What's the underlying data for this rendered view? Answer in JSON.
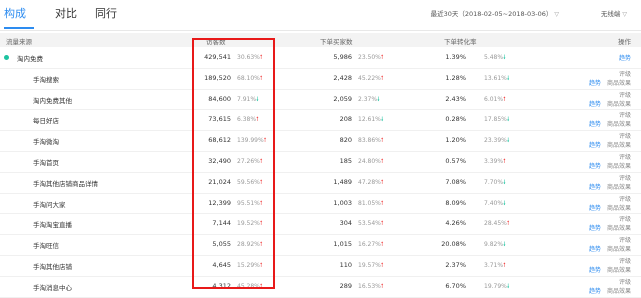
{
  "tabs": [
    {
      "label": "构成",
      "active": true
    },
    {
      "label": "对比",
      "active": false
    },
    {
      "label": "同行",
      "active": false
    }
  ],
  "date_range": "最近30天（2018-02-05~2018-03-06）",
  "terminal_select": "无线端",
  "headers": {
    "source": "流量来源",
    "visitors": "访客数",
    "buyers": "下单买家数",
    "conversion": "下单转化率",
    "actions": "操作"
  },
  "colors": {
    "accent": "#2d8cf0",
    "up": "#f04848",
    "down": "#1dc3a0",
    "highlight_box": "#e81919"
  },
  "rows": [
    {
      "source": "淘内免费",
      "is_parent": true,
      "visitors": "429,541",
      "visitors_pct": "30.63%",
      "visitors_trend": "up",
      "buyers": "5,986",
      "buyers_pct": "23.50%",
      "buyers_trend": "up",
      "conversion": "1.39%",
      "conversion_pct": "5.48%",
      "conversion_trend": "down",
      "actions": [
        "趋势"
      ]
    },
    {
      "source": "手淘搜索",
      "visitors": "189,520",
      "visitors_pct": "68.10%",
      "visitors_trend": "up",
      "buyers": "2,428",
      "buyers_pct": "45.22%",
      "buyers_trend": "up",
      "conversion": "1.28%",
      "conversion_pct": "13.61%",
      "conversion_trend": "down",
      "actions": [
        "评级",
        "趋势",
        "商品效果"
      ]
    },
    {
      "source": "淘内免费其他",
      "visitors": "84,600",
      "visitors_pct": "7.91%",
      "visitors_trend": "down",
      "buyers": "2,059",
      "buyers_pct": "2.37%",
      "buyers_trend": "down",
      "conversion": "2.43%",
      "conversion_pct": "6.01%",
      "conversion_trend": "up",
      "actions": [
        "评级",
        "趋势",
        "商品效果"
      ]
    },
    {
      "source": "每日好店",
      "visitors": "73,615",
      "visitors_pct": "6.38%",
      "visitors_trend": "up",
      "buyers": "208",
      "buyers_pct": "12.61%",
      "buyers_trend": "down",
      "conversion": "0.28%",
      "conversion_pct": "17.85%",
      "conversion_trend": "down",
      "actions": [
        "评级",
        "趋势",
        "商品效果"
      ]
    },
    {
      "source": "手淘微淘",
      "visitors": "68,612",
      "visitors_pct": "139.99%",
      "visitors_trend": "up",
      "buyers": "820",
      "buyers_pct": "83.86%",
      "buyers_trend": "up",
      "conversion": "1.20%",
      "conversion_pct": "23.39%",
      "conversion_trend": "down",
      "actions": [
        "评级",
        "趋势",
        "商品效果"
      ]
    },
    {
      "source": "手淘首页",
      "visitors": "32,490",
      "visitors_pct": "27.26%",
      "visitors_trend": "up",
      "buyers": "185",
      "buyers_pct": "24.80%",
      "buyers_trend": "up",
      "conversion": "0.57%",
      "conversion_pct": "3.39%",
      "conversion_trend": "up",
      "actions": [
        "评级",
        "趋势",
        "商品效果"
      ]
    },
    {
      "source": "手淘其他店铺商品详情",
      "visitors": "21,024",
      "visitors_pct": "59.56%",
      "visitors_trend": "up",
      "buyers": "1,489",
      "buyers_pct": "47.28%",
      "buyers_trend": "up",
      "conversion": "7.08%",
      "conversion_pct": "7.70%",
      "conversion_trend": "down",
      "actions": [
        "评级",
        "趋势",
        "商品效果"
      ]
    },
    {
      "source": "手淘问大家",
      "visitors": "12,399",
      "visitors_pct": "95.51%",
      "visitors_trend": "up",
      "buyers": "1,003",
      "buyers_pct": "81.05%",
      "buyers_trend": "up",
      "conversion": "8.09%",
      "conversion_pct": "7.40%",
      "conversion_trend": "down",
      "actions": [
        "评级",
        "趋势",
        "商品效果"
      ]
    },
    {
      "source": "手淘淘宝直播",
      "visitors": "7,144",
      "visitors_pct": "19.52%",
      "visitors_trend": "up",
      "buyers": "304",
      "buyers_pct": "53.54%",
      "buyers_trend": "up",
      "conversion": "4.26%",
      "conversion_pct": "28.45%",
      "conversion_trend": "up",
      "actions": [
        "评级",
        "趋势",
        "商品效果"
      ]
    },
    {
      "source": "手淘旺信",
      "visitors": "5,055",
      "visitors_pct": "28.92%",
      "visitors_trend": "up",
      "buyers": "1,015",
      "buyers_pct": "16.27%",
      "buyers_trend": "up",
      "conversion": "20.08%",
      "conversion_pct": "9.82%",
      "conversion_trend": "down",
      "actions": [
        "评级",
        "趋势",
        "商品效果"
      ]
    },
    {
      "source": "手淘其他店铺",
      "visitors": "4,645",
      "visitors_pct": "15.29%",
      "visitors_trend": "up",
      "buyers": "110",
      "buyers_pct": "19.57%",
      "buyers_trend": "up",
      "conversion": "2.37%",
      "conversion_pct": "3.71%",
      "conversion_trend": "up",
      "actions": [
        "评级",
        "趋势",
        "商品效果"
      ]
    },
    {
      "source": "手淘消息中心",
      "visitors": "4,312",
      "visitors_pct": "45.28%",
      "visitors_trend": "up",
      "buyers": "289",
      "buyers_pct": "16.53%",
      "buyers_trend": "up",
      "conversion": "6.70%",
      "conversion_pct": "19.79%",
      "conversion_trend": "down",
      "actions": [
        "评级",
        "趋势",
        "商品效果"
      ]
    }
  ]
}
